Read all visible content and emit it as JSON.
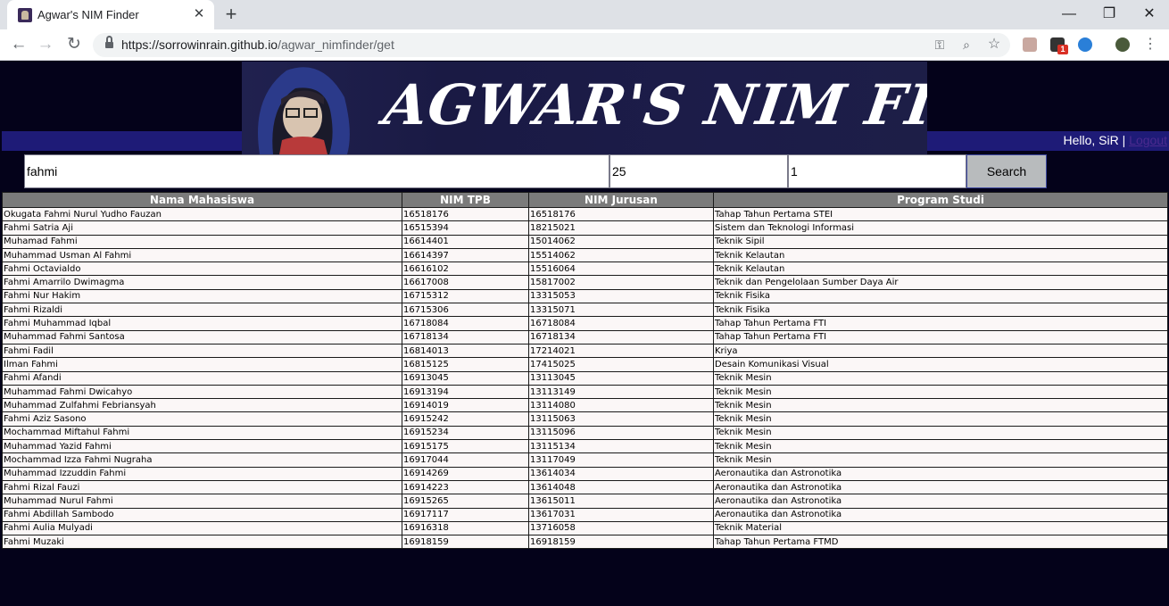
{
  "browser": {
    "tab_title": "Agwar's NIM Finder",
    "tab_close": "✕",
    "new_tab": "+",
    "url_host": "https://sorrowinrain.github.io",
    "url_path": "/agwar_nimfinder/get",
    "window_controls": {
      "minimize": "—",
      "restore": "❐",
      "close": "✕"
    },
    "extension_badge": "1"
  },
  "header": {
    "banner_title": "AGWAR'S NIM FINDER",
    "greeting": "Hello, SiR | ",
    "logout_label": "Logout"
  },
  "search": {
    "query": "fahmi",
    "limit": "25",
    "page": "1",
    "button_label": "Search"
  },
  "table": {
    "headers": [
      "Nama Mahasiswa",
      "NIM TPB",
      "NIM Jurusan",
      "Program Studi"
    ],
    "rows": [
      [
        "Okugata Fahmi Nurul Yudho Fauzan",
        "16518176",
        "16518176",
        "Tahap Tahun Pertama STEI"
      ],
      [
        "Fahmi Satria Aji",
        "16515394",
        "18215021",
        "Sistem dan Teknologi Informasi"
      ],
      [
        "Muhamad Fahmi",
        "16614401",
        "15014062",
        "Teknik Sipil"
      ],
      [
        "Muhammad Usman Al Fahmi",
        "16614397",
        "15514062",
        "Teknik Kelautan"
      ],
      [
        "Fahmi Octavialdo",
        "16616102",
        "15516064",
        "Teknik Kelautan"
      ],
      [
        "Fahmi Amarrilo Dwimagma",
        "16617008",
        "15817002",
        "Teknik dan Pengelolaan Sumber Daya Air"
      ],
      [
        "Fahmi Nur Hakim",
        "16715312",
        "13315053",
        "Teknik Fisika"
      ],
      [
        "Fahmi Rizaldi",
        "16715306",
        "13315071",
        "Teknik Fisika"
      ],
      [
        "Fahmi Muhammad Iqbal",
        "16718084",
        "16718084",
        "Tahap Tahun Pertama FTI"
      ],
      [
        "Muhammad Fahmi Santosa",
        "16718134",
        "16718134",
        "Tahap Tahun Pertama FTI"
      ],
      [
        "Fahmi Fadil",
        "16814013",
        "17214021",
        "Kriya"
      ],
      [
        "Ilman Fahmi",
        "16815125",
        "17415025",
        "Desain Komunikasi Visual"
      ],
      [
        "Fahmi Afandi",
        "16913045",
        "13113045",
        "Teknik Mesin"
      ],
      [
        "Muhammad Fahmi Dwicahyo",
        "16913194",
        "13113149",
        "Teknik Mesin"
      ],
      [
        "Muhammad Zulfahmi Febriansyah",
        "16914019",
        "13114080",
        "Teknik Mesin"
      ],
      [
        "Fahmi Aziz Sasono",
        "16915242",
        "13115063",
        "Teknik Mesin"
      ],
      [
        "Mochammad Miftahul Fahmi",
        "16915234",
        "13115096",
        "Teknik Mesin"
      ],
      [
        "Muhammad Yazid Fahmi",
        "16915175",
        "13115134",
        "Teknik Mesin"
      ],
      [
        "Mochammad Izza Fahmi Nugraha",
        "16917044",
        "13117049",
        "Teknik Mesin"
      ],
      [
        "Muhammad Izzuddin Fahmi",
        "16914269",
        "13614034",
        "Aeronautika dan Astronotika"
      ],
      [
        "Fahmi Rizal Fauzi",
        "16914223",
        "13614048",
        "Aeronautika dan Astronotika"
      ],
      [
        "Muhammad Nurul Fahmi",
        "16915265",
        "13615011",
        "Aeronautika dan Astronotika"
      ],
      [
        "Fahmi Abdillah Sambodo",
        "16917117",
        "13617031",
        "Aeronautika dan Astronotika"
      ],
      [
        "Fahmi Aulia Mulyadi",
        "16916318",
        "13716058",
        "Teknik Material"
      ],
      [
        "Fahmi Muzaki",
        "16918159",
        "16918159",
        "Tahap Tahun Pertama FTMD"
      ]
    ]
  }
}
